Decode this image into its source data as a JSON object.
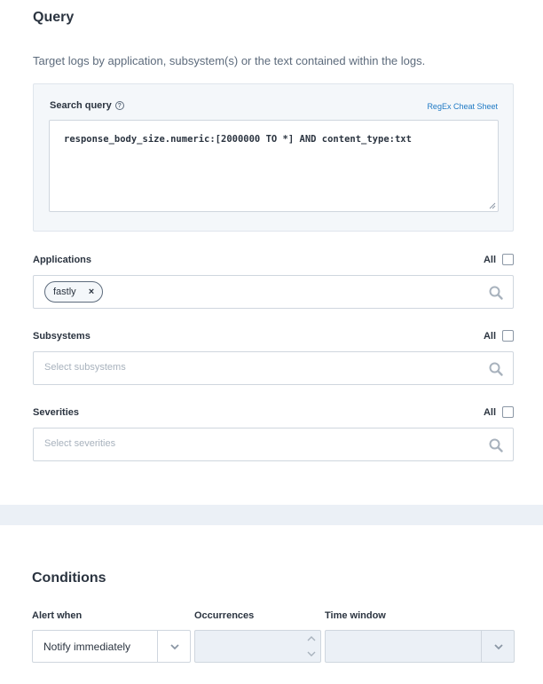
{
  "query": {
    "title": "Query",
    "subtitle": "Target logs by application, subsystem(s) or the text contained within the logs.",
    "search_label": "Search query",
    "help_glyph": "?",
    "cheat_sheet_link": "RegEx Cheat Sheet",
    "search_value": "response_body_size.numeric:[2000000 TO *] AND content_type:txt"
  },
  "applications": {
    "label": "Applications",
    "all_label": "All",
    "all_checked": false,
    "chips": [
      {
        "label": "fastly",
        "remove": "×"
      }
    ]
  },
  "subsystems": {
    "label": "Subsystems",
    "all_label": "All",
    "all_checked": false,
    "placeholder": "Select subsystems"
  },
  "severities": {
    "label": "Severities",
    "all_label": "All",
    "all_checked": false,
    "placeholder": "Select severities"
  },
  "conditions": {
    "title": "Conditions",
    "alert_when_label": "Alert when",
    "alert_when_value": "Notify immediately",
    "occurrences_label": "Occurrences",
    "occurrences_value": "",
    "time_window_label": "Time window",
    "time_window_value": ""
  },
  "colors": {
    "link": "#1f7ac4",
    "text": "#2b3440",
    "panel_bg": "#f4f7fa",
    "disabled_bg": "#ebf0f6",
    "border": "#cfd6de"
  }
}
